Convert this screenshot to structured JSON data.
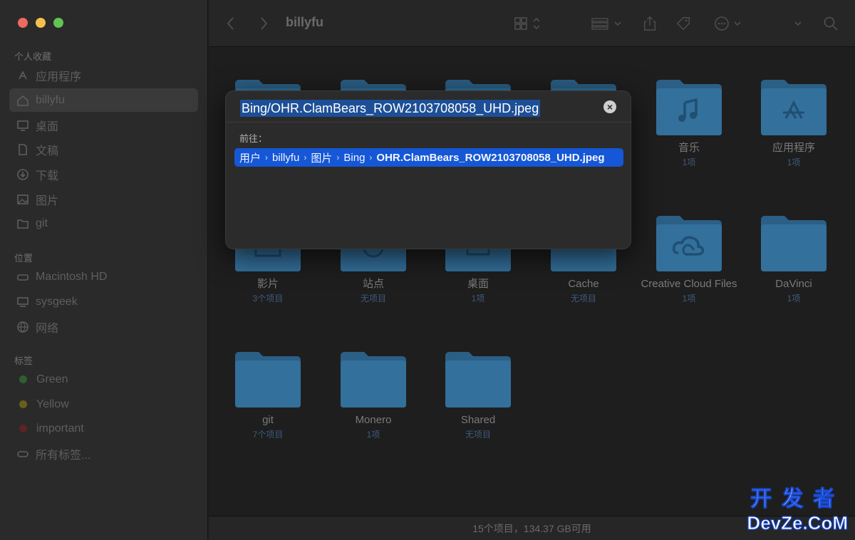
{
  "window": {
    "title": "billyfu"
  },
  "sidebar": {
    "favorites_title": "个人收藏",
    "favorites": [
      {
        "label": "应用程序",
        "icon": "applications-icon"
      },
      {
        "label": "billyfu",
        "icon": "home-icon",
        "active": true
      },
      {
        "label": "桌面",
        "icon": "desktop-icon"
      },
      {
        "label": "文稿",
        "icon": "document-icon"
      },
      {
        "label": "下载",
        "icon": "download-icon"
      },
      {
        "label": "图片",
        "icon": "pictures-icon"
      },
      {
        "label": "git",
        "icon": "folder-icon"
      }
    ],
    "locations_title": "位置",
    "locations": [
      {
        "label": "Macintosh HD",
        "icon": "disk-icon"
      },
      {
        "label": "sysgeek",
        "icon": "computer-icon"
      },
      {
        "label": "网络",
        "icon": "network-icon"
      }
    ],
    "tags_title": "标签",
    "tags": [
      {
        "label": "Green",
        "color": "#2e7d32"
      },
      {
        "label": "Yellow",
        "color": "#8a7a1a"
      },
      {
        "label": "important",
        "color": "#7a2222"
      }
    ],
    "all_tags": "所有标签..."
  },
  "folders": [
    {
      "name": "音乐",
      "count": "1项",
      "icon": "music-note-icon"
    },
    {
      "name": "应用程序",
      "count": "1项",
      "icon": "app-store-icon"
    },
    {
      "name": "影片",
      "count": "3个项目",
      "icon": "film-icon"
    },
    {
      "name": "站点",
      "count": "无项目",
      "icon": "globe-icon"
    },
    {
      "name": "桌面",
      "count": "1项",
      "icon": "desktop-icon"
    },
    {
      "name": "Cache",
      "count": "无项目",
      "icon": "folder-icon"
    },
    {
      "name": "Creative Cloud Files",
      "count": "1项",
      "icon": "creative-cloud-icon"
    },
    {
      "name": "DaVinci",
      "count": "1项",
      "icon": "folder-icon"
    },
    {
      "name": "git",
      "count": "7个项目",
      "icon": "folder-icon"
    },
    {
      "name": "Monero",
      "count": "1项",
      "icon": "folder-icon"
    },
    {
      "name": "Shared",
      "count": "无项目",
      "icon": "folder-icon"
    }
  ],
  "status": {
    "text": "15个项目，134.37 GB可用"
  },
  "goto": {
    "input_value": "Bing/OHR.ClamBears_ROW2103708058_UHD.jpeg",
    "label": "前往：",
    "path": [
      "用户",
      "billyfu",
      "图片",
      "Bing",
      "OHR.ClamBears_ROW2103708058_UHD.jpeg"
    ]
  },
  "watermark": {
    "top": "开发者",
    "bottom": "DevZe.CoM"
  }
}
